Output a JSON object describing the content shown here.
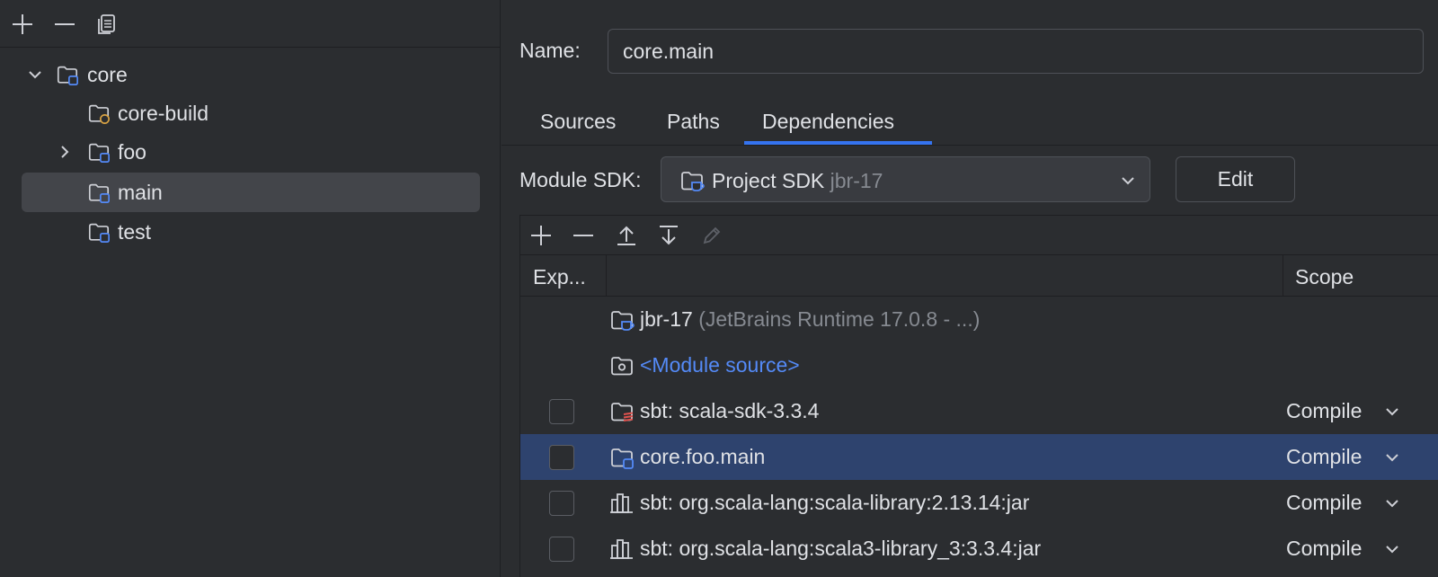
{
  "left_toolbar": {
    "add_icon": "plus-icon",
    "remove_icon": "minus-icon",
    "copy_icon": "copy-icon"
  },
  "tree": [
    {
      "label": "core",
      "expanded": true,
      "icon": "module-folder-icon"
    },
    {
      "label": "core-build",
      "icon": "build-module-folder-icon"
    },
    {
      "label": "foo",
      "expanded": false,
      "icon": "module-folder-icon"
    },
    {
      "label": "main",
      "selected": true,
      "icon": "module-folder-icon"
    },
    {
      "label": "test",
      "icon": "module-folder-icon"
    }
  ],
  "form": {
    "name_label": "Name:",
    "name_value": "core.main"
  },
  "tabs": [
    {
      "label": "Sources"
    },
    {
      "label": "Paths"
    },
    {
      "label": "Dependencies",
      "active": true
    }
  ],
  "sdk": {
    "label": "Module SDK:",
    "value": "Project SDK",
    "value_hint": "jbr-17",
    "edit_label": "Edit"
  },
  "deps_toolbar": {
    "add": "plus-icon",
    "remove": "minus-icon",
    "move_up": "move-up-icon",
    "move_down": "move-down-icon",
    "edit": "pencil-icon"
  },
  "deps_table": {
    "col_export": "Exp...",
    "col_scope": "Scope",
    "rows": [
      {
        "name": "jbr-17",
        "hint": "(JetBrains Runtime 17.0.8 - ...)",
        "icon": "sdk-icon",
        "checkbox": false,
        "scope": ""
      },
      {
        "name": "<Module source>",
        "link": true,
        "icon": "module-source-icon",
        "checkbox": false,
        "scope": ""
      },
      {
        "name": "sbt: scala-sdk-3.3.4",
        "icon": "scala-sdk-icon",
        "checkbox": true,
        "scope": "Compile"
      },
      {
        "name": "core.foo.main",
        "icon": "module-folder-icon",
        "checkbox": true,
        "scope": "Compile",
        "selected": true
      },
      {
        "name": "sbt: org.scala-lang:scala-library:2.13.14:jar",
        "icon": "library-icon",
        "checkbox": true,
        "scope": "Compile"
      },
      {
        "name": "sbt: org.scala-lang:scala3-library_3:3.3.4:jar",
        "icon": "library-icon",
        "checkbox": true,
        "scope": "Compile"
      }
    ]
  },
  "colors": {
    "background": "#2b2d30",
    "selection_tree": "#43454a",
    "selection_table": "#2e436e",
    "accent": "#3574f0",
    "link": "#548af7",
    "text": "#dfe1e5",
    "text_dim": "#868a91"
  }
}
